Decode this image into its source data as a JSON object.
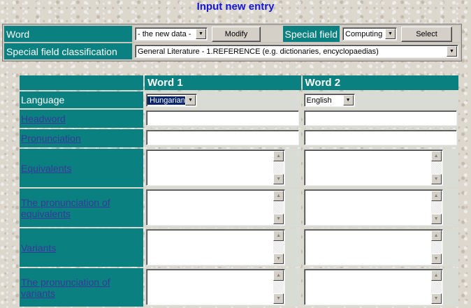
{
  "page": {
    "title": "Input new entry"
  },
  "top_form": {
    "word_label": "Word",
    "word_select_value": "- the new data -",
    "modify_button": "Modify",
    "special_field_label": "Special field",
    "special_field_value": "Computing",
    "select_button": "Select",
    "classification_label": "Special field classification",
    "classification_value": "General Literature - 1.REFERENCE (e.g. dictionaries, encyclopaedias)"
  },
  "entry_table": {
    "col1_header": "Word 1",
    "col2_header": "Word 2",
    "language_label": "Language",
    "language1_value": "Hungarian",
    "language2_value": "English",
    "rows": {
      "headword": "Headword",
      "pronunciation": "Pronunciation",
      "equivalents": "Equivalents",
      "equiv_pronunciation": "The pronunciation of equivalents",
      "variants": "Variants",
      "variant_pronunciation": "The pronunciation of variants"
    }
  },
  "icons": {
    "dropdown": "triangle-down",
    "scroll_up": "triangle-up",
    "scroll_down": "triangle-down"
  },
  "colors": {
    "teal": "#0a8080",
    "title_blue": "#1515d8",
    "link": "#38389a"
  }
}
